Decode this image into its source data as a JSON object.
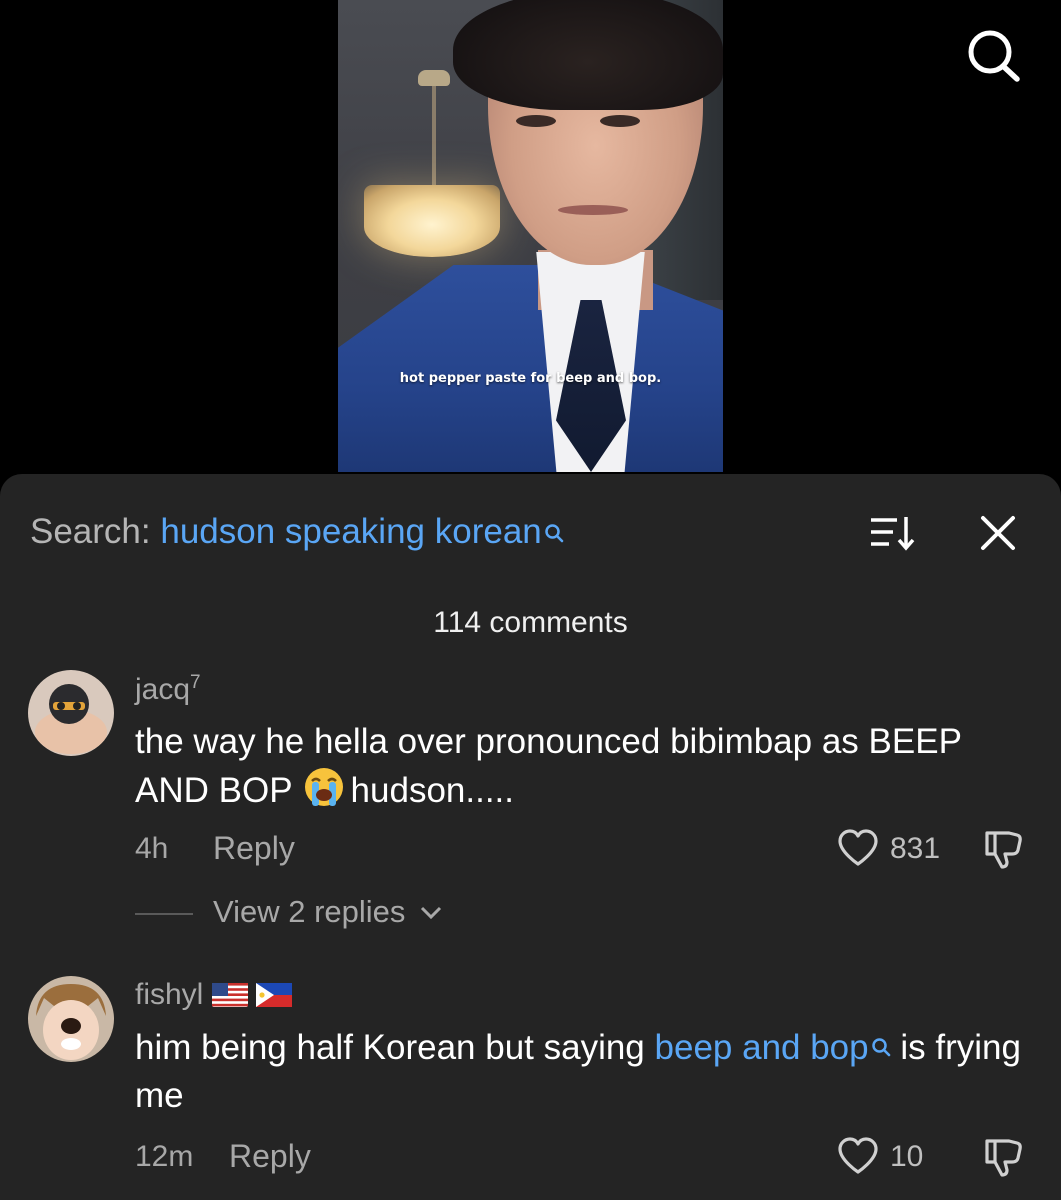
{
  "video": {
    "caption": "hot pepper paste for beep and bop."
  },
  "top_bar": {
    "search_icon": "search-icon"
  },
  "comments_sheet": {
    "search_prefix": "Search:",
    "search_term": "hudson speaking korean",
    "count_label": "114 comments",
    "sort_icon": "sort-icon",
    "close_icon": "close-icon"
  },
  "comments": [
    {
      "username": "jacq",
      "username_sup": "7",
      "text_1": "the way he hella over pronounced bibimbap as BEEP AND BOP",
      "emoji": "loudly-crying-face",
      "text_2": "hudson.....",
      "time": "4h",
      "reply_label": "Reply",
      "like_count": "831",
      "view_replies": "View 2 replies"
    },
    {
      "username": "fishyl",
      "flags": [
        "US flag",
        "Philippines flag"
      ],
      "text_1": "him being half Korean but saying",
      "link": "beep and bop",
      "text_2": "is frying me",
      "time": "12m",
      "reply_label": "Reply",
      "like_count": "10"
    }
  ],
  "colors": {
    "sheet_bg": "#242424",
    "link": "#5aa6f5",
    "muted": "#a8a8a8"
  }
}
